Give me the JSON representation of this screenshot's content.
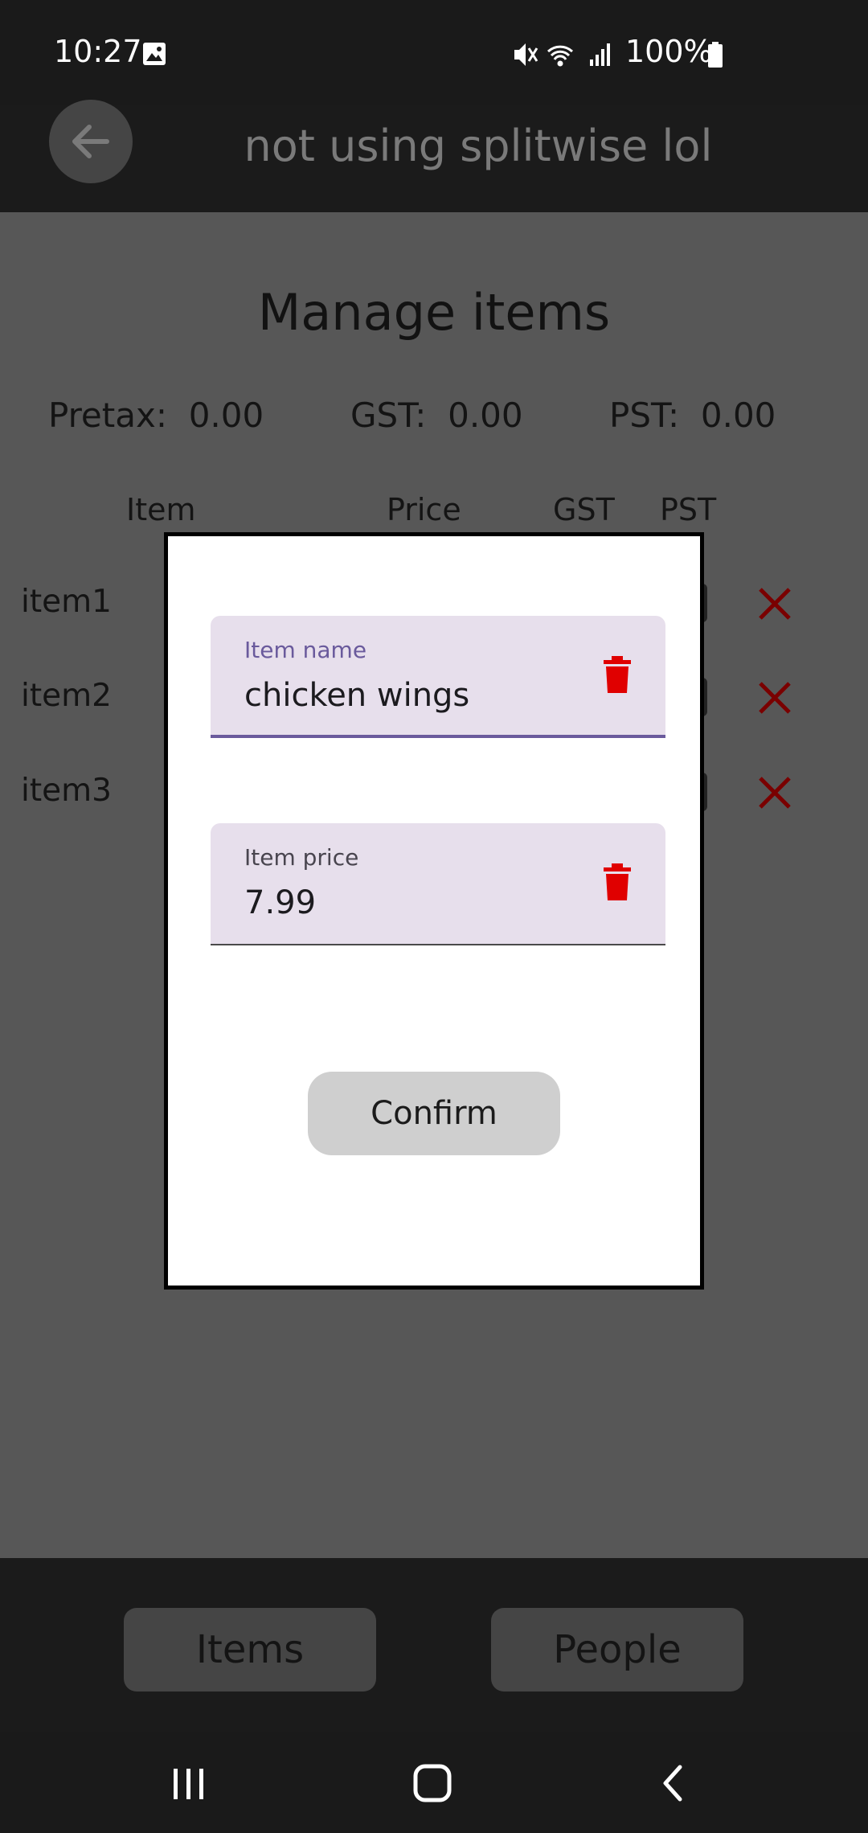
{
  "status_bar": {
    "time": "10:27",
    "battery_percent": "100%",
    "icons": [
      "image-icon",
      "mute-icon",
      "wifi-icon",
      "signal-icon",
      "battery-icon"
    ]
  },
  "app_bar": {
    "title": "not using splitwise lol",
    "back_icon": "arrow-left-icon"
  },
  "main": {
    "title": "Manage items",
    "totals": [
      {
        "label": "Pretax:",
        "value": "0.00"
      },
      {
        "label": "GST:",
        "value": "0.00"
      },
      {
        "label": "PST:",
        "value": "0.00"
      }
    ],
    "columns": [
      "Item",
      "Price",
      "GST",
      "PST"
    ],
    "rows": [
      {
        "name": "item1"
      },
      {
        "name": "item2"
      },
      {
        "name": "item3"
      }
    ]
  },
  "dialog": {
    "name_field": {
      "label": "Item name",
      "value": "chicken wings"
    },
    "price_field": {
      "label": "Item price",
      "value": "7.99"
    },
    "confirm_label": "Confirm"
  },
  "bottom_tabs": {
    "items_label": "Items",
    "people_label": "People"
  },
  "colors": {
    "accent": "#6a5a9c",
    "delete": "#e00000",
    "field_bg": "#e7dfec"
  }
}
